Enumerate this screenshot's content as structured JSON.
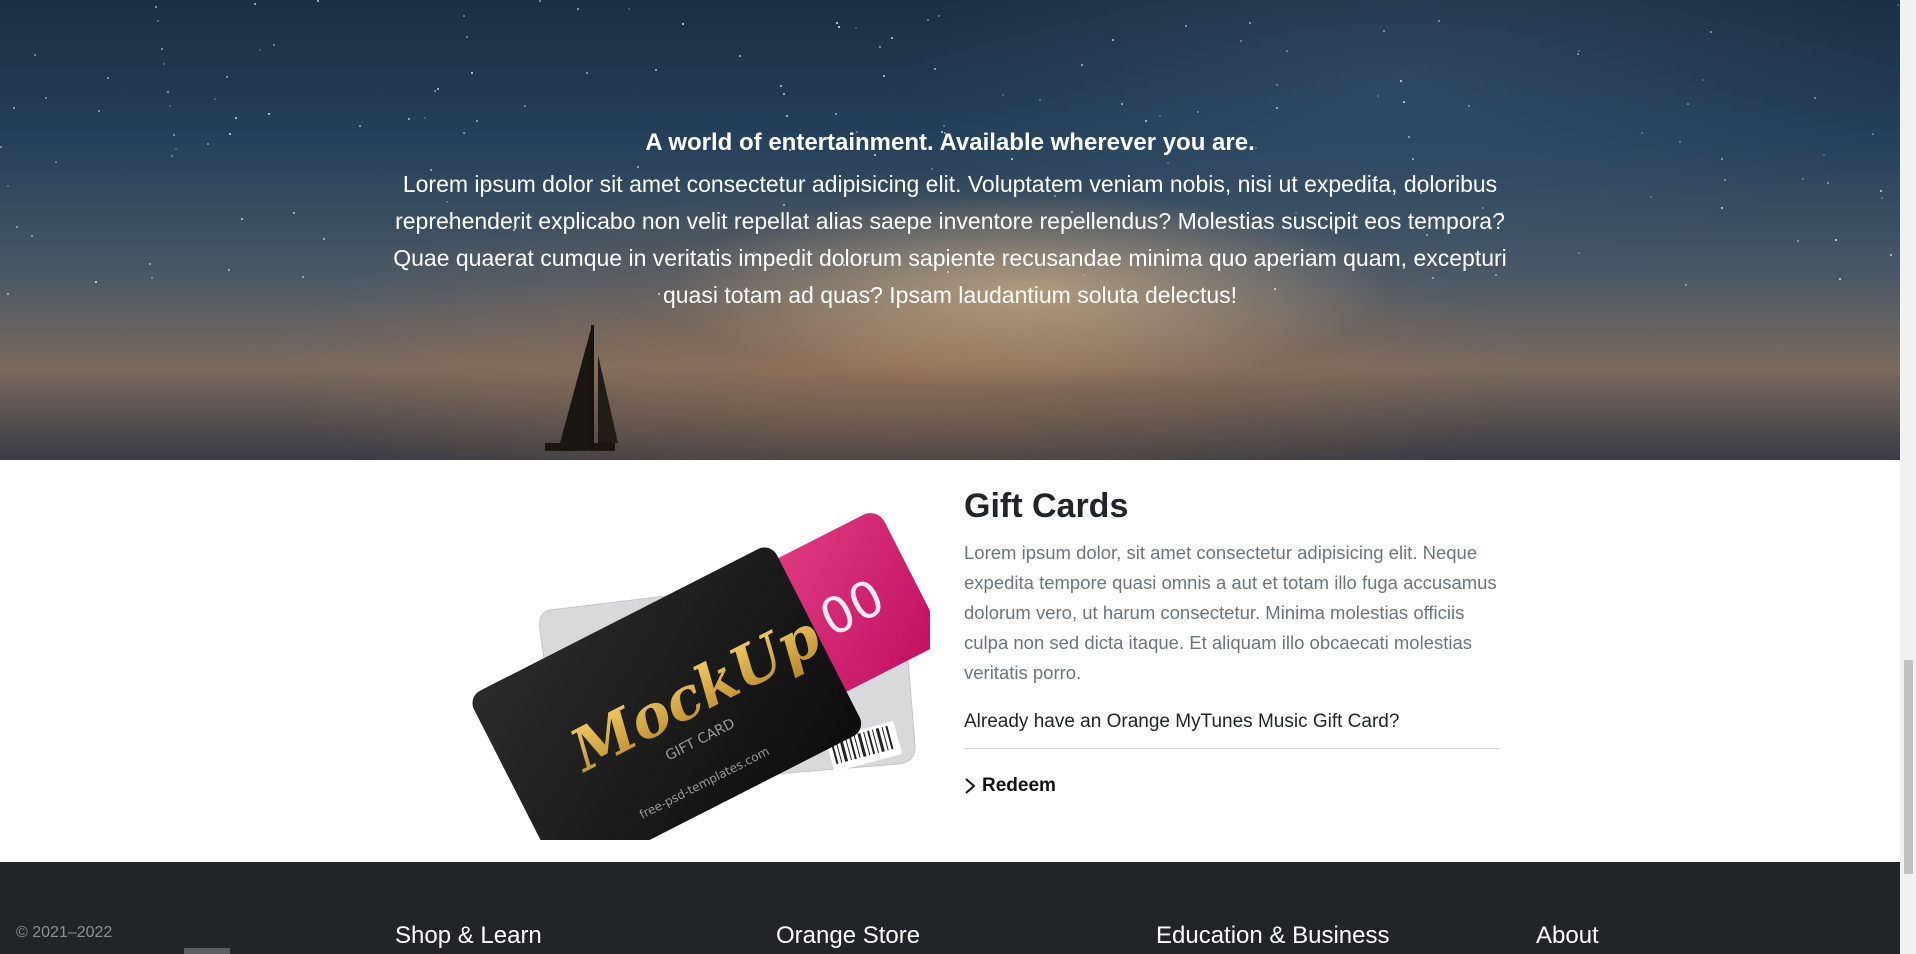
{
  "hero": {
    "title": "A world of entertainment. Available wherever you are.",
    "body": "Lorem ipsum dolor sit amet consectetur adipisicing elit. Voluptatem veniam nobis, nisi ut expedita, doloribus reprehenderit explicabo non velit repellat alias saepe inventore repellendus? Molestias suscipit eos tempora? Quae quaerat cumque in veritatis impedit dolorum sapiente recusandae minima quo aperiam quam, excepturi quasi totam ad quas? Ipsam laudantium soluta delectus!"
  },
  "gift": {
    "title": "Gift Cards",
    "description": "Lorem ipsum dolor, sit amet consectetur adipisicing elit. Neque expedita tempore quasi omnis a aut et totam illo fuga accusamus dolorum vero, ut harum consectetur. Minima molestias officiis culpa non sed dicta itaque. Et aliquam illo obcaecati molestias veritatis porro.",
    "question": "Already have an Orange MyTunes Music Gift Card?",
    "redeem_label": "Redeem",
    "card_brand": "MockUp",
    "card_sub": "GIFT CARD",
    "card_url": "free-psd-templates.com",
    "card_value": "00"
  },
  "footer": {
    "copyright": "© 2021–2022",
    "columns": [
      "Shop & Learn",
      "Orange Store",
      "Education & Business",
      "About"
    ]
  },
  "colors": {
    "footer_bg": "#212529",
    "card_pink": "#d81b70",
    "card_black": "#1a1a1a",
    "card_gold": "#e0b040"
  }
}
